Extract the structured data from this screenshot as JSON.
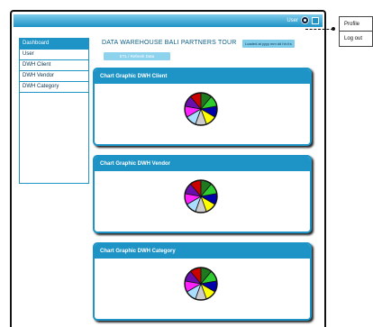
{
  "header": {
    "user_label": "User",
    "avatar_icon": "user-avatar-icon",
    "menu_icon": "menu-toggle-icon"
  },
  "user_menu": {
    "items": [
      {
        "label": "Profile"
      },
      {
        "label": "Log out"
      }
    ]
  },
  "sidebar": {
    "items": [
      {
        "label": "Dashboard",
        "active": true
      },
      {
        "label": "User",
        "active": false
      },
      {
        "label": "DWH Client",
        "active": false
      },
      {
        "label": "DWH Vendor",
        "active": false
      },
      {
        "label": "DWH Category",
        "active": false
      }
    ]
  },
  "main": {
    "title": "DATA WAREHOUSE BALI PARTNERS TOUR",
    "status_text": "Loaded at yyyy mm dd hh:ii:s",
    "refresh_label": "ETL / Refresh Data"
  },
  "cards": [
    {
      "title": "Chart Graphic DWH Client"
    },
    {
      "title": "Chart Graphic DWH Vendor"
    },
    {
      "title": "Chart Graphic DWH Category"
    }
  ],
  "pie_colors": [
    "#1f7a1f",
    "#2ecc2e",
    "#0000aa",
    "#ffff00",
    "#cccccc",
    "#aaddff",
    "#ff22ff",
    "#6a0dad",
    "#cc0000"
  ],
  "colors": {
    "accent": "#1d93c6",
    "accent_light": "#7ecbea"
  }
}
